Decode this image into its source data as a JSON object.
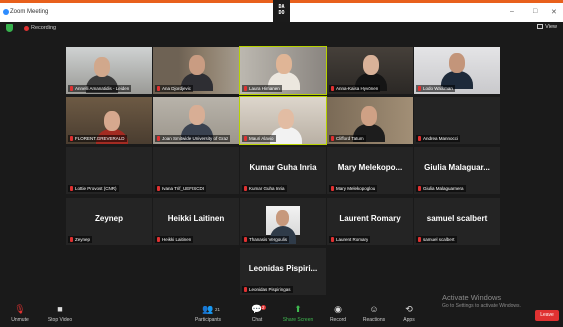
{
  "window": {
    "title": "Zoom Meeting",
    "logo_text": "DA\nDO",
    "controls": [
      "–",
      "□",
      "✕"
    ]
  },
  "status": {
    "recording_label": "Recording",
    "view_label": "View"
  },
  "participants": [
    {
      "name": "Annelli Amanatidis - Leiden",
      "video": true
    },
    {
      "name": "Ana Djordjevic",
      "video": true
    },
    {
      "name": "Laura Himanen",
      "video": true,
      "active": true
    },
    {
      "name": "Anna-Kaisa Hyvönen",
      "video": true
    },
    {
      "name": "Lodo Walkman",
      "video": true
    },
    {
      "name": "FLORENT.GREVERALD",
      "video": true
    },
    {
      "name": "Joan Smitwide University of Graz",
      "video": true
    },
    {
      "name": "Mauri Alavio",
      "video": true,
      "active": true
    },
    {
      "name": "Clifford Tatum",
      "video": true
    },
    {
      "name": "Andrea Mannocci",
      "video": false,
      "display": ""
    },
    {
      "name": "Lottie Provost (CNR)",
      "video": false,
      "display": ""
    },
    {
      "name": "Ivana Trif_UEFISCDI",
      "video": false,
      "display": ""
    },
    {
      "name": "Kumar Guha Inria",
      "video": false,
      "display": "Kumar Guha Inria"
    },
    {
      "name": "Mary Melekopoglou",
      "video": false,
      "display": "Mary Melekopo..."
    },
    {
      "name": "Giulia Malaguarnera",
      "video": false,
      "display": "Giulia Malaguar..."
    },
    {
      "name": "Zeynep",
      "video": false,
      "display": "Zeynep"
    },
    {
      "name": "Heikki Laitinen",
      "video": false,
      "display": "Heikki Laitinen"
    },
    {
      "name": "Thanasis Vergoulis",
      "video": true
    },
    {
      "name": "Laurent Romary",
      "video": false,
      "display": "Laurent Romary"
    },
    {
      "name": "samuel scalbert",
      "video": false,
      "display": "samuel scalbert"
    },
    {
      "name": "Leonidas Pispiringas",
      "video": false,
      "display": "Leonidas Pispiri..."
    }
  ],
  "toolbar": {
    "unmute": "Unmute",
    "stop_video": "Stop Video",
    "participants": "Participants",
    "participants_count": "21",
    "chat": "Chat",
    "chat_badge": "2",
    "share_screen": "Share Screen",
    "record": "Record",
    "reactions": "Reactions",
    "apps": "Apps",
    "leave": "Leave"
  },
  "watermark": {
    "line1": "Activate Windows",
    "line2": "Go to Settings to activate Windows."
  },
  "colors": {
    "accent": "#e8601c",
    "active_speaker": "#b6d100",
    "mic_muted": "#e03131",
    "share": "#3fb950",
    "leave": "#e03131"
  }
}
